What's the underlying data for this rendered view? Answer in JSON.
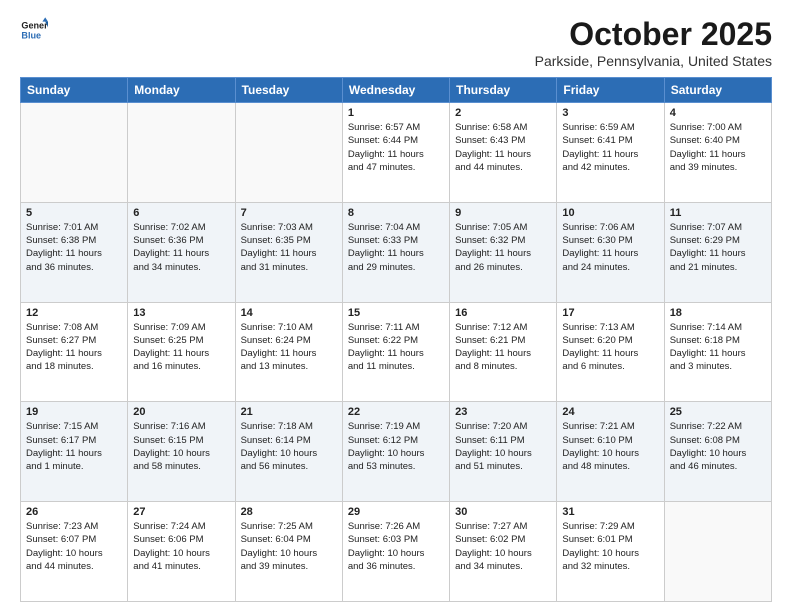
{
  "header": {
    "logo_line1": "General",
    "logo_line2": "Blue",
    "title": "October 2025",
    "subtitle": "Parkside, Pennsylvania, United States"
  },
  "days_of_week": [
    "Sunday",
    "Monday",
    "Tuesday",
    "Wednesday",
    "Thursday",
    "Friday",
    "Saturday"
  ],
  "weeks": [
    [
      {
        "day": "",
        "info": ""
      },
      {
        "day": "",
        "info": ""
      },
      {
        "day": "",
        "info": ""
      },
      {
        "day": "1",
        "info": "Sunrise: 6:57 AM\nSunset: 6:44 PM\nDaylight: 11 hours\nand 47 minutes."
      },
      {
        "day": "2",
        "info": "Sunrise: 6:58 AM\nSunset: 6:43 PM\nDaylight: 11 hours\nand 44 minutes."
      },
      {
        "day": "3",
        "info": "Sunrise: 6:59 AM\nSunset: 6:41 PM\nDaylight: 11 hours\nand 42 minutes."
      },
      {
        "day": "4",
        "info": "Sunrise: 7:00 AM\nSunset: 6:40 PM\nDaylight: 11 hours\nand 39 minutes."
      }
    ],
    [
      {
        "day": "5",
        "info": "Sunrise: 7:01 AM\nSunset: 6:38 PM\nDaylight: 11 hours\nand 36 minutes."
      },
      {
        "day": "6",
        "info": "Sunrise: 7:02 AM\nSunset: 6:36 PM\nDaylight: 11 hours\nand 34 minutes."
      },
      {
        "day": "7",
        "info": "Sunrise: 7:03 AM\nSunset: 6:35 PM\nDaylight: 11 hours\nand 31 minutes."
      },
      {
        "day": "8",
        "info": "Sunrise: 7:04 AM\nSunset: 6:33 PM\nDaylight: 11 hours\nand 29 minutes."
      },
      {
        "day": "9",
        "info": "Sunrise: 7:05 AM\nSunset: 6:32 PM\nDaylight: 11 hours\nand 26 minutes."
      },
      {
        "day": "10",
        "info": "Sunrise: 7:06 AM\nSunset: 6:30 PM\nDaylight: 11 hours\nand 24 minutes."
      },
      {
        "day": "11",
        "info": "Sunrise: 7:07 AM\nSunset: 6:29 PM\nDaylight: 11 hours\nand 21 minutes."
      }
    ],
    [
      {
        "day": "12",
        "info": "Sunrise: 7:08 AM\nSunset: 6:27 PM\nDaylight: 11 hours\nand 18 minutes."
      },
      {
        "day": "13",
        "info": "Sunrise: 7:09 AM\nSunset: 6:25 PM\nDaylight: 11 hours\nand 16 minutes."
      },
      {
        "day": "14",
        "info": "Sunrise: 7:10 AM\nSunset: 6:24 PM\nDaylight: 11 hours\nand 13 minutes."
      },
      {
        "day": "15",
        "info": "Sunrise: 7:11 AM\nSunset: 6:22 PM\nDaylight: 11 hours\nand 11 minutes."
      },
      {
        "day": "16",
        "info": "Sunrise: 7:12 AM\nSunset: 6:21 PM\nDaylight: 11 hours\nand 8 minutes."
      },
      {
        "day": "17",
        "info": "Sunrise: 7:13 AM\nSunset: 6:20 PM\nDaylight: 11 hours\nand 6 minutes."
      },
      {
        "day": "18",
        "info": "Sunrise: 7:14 AM\nSunset: 6:18 PM\nDaylight: 11 hours\nand 3 minutes."
      }
    ],
    [
      {
        "day": "19",
        "info": "Sunrise: 7:15 AM\nSunset: 6:17 PM\nDaylight: 11 hours\nand 1 minute."
      },
      {
        "day": "20",
        "info": "Sunrise: 7:16 AM\nSunset: 6:15 PM\nDaylight: 10 hours\nand 58 minutes."
      },
      {
        "day": "21",
        "info": "Sunrise: 7:18 AM\nSunset: 6:14 PM\nDaylight: 10 hours\nand 56 minutes."
      },
      {
        "day": "22",
        "info": "Sunrise: 7:19 AM\nSunset: 6:12 PM\nDaylight: 10 hours\nand 53 minutes."
      },
      {
        "day": "23",
        "info": "Sunrise: 7:20 AM\nSunset: 6:11 PM\nDaylight: 10 hours\nand 51 minutes."
      },
      {
        "day": "24",
        "info": "Sunrise: 7:21 AM\nSunset: 6:10 PM\nDaylight: 10 hours\nand 48 minutes."
      },
      {
        "day": "25",
        "info": "Sunrise: 7:22 AM\nSunset: 6:08 PM\nDaylight: 10 hours\nand 46 minutes."
      }
    ],
    [
      {
        "day": "26",
        "info": "Sunrise: 7:23 AM\nSunset: 6:07 PM\nDaylight: 10 hours\nand 44 minutes."
      },
      {
        "day": "27",
        "info": "Sunrise: 7:24 AM\nSunset: 6:06 PM\nDaylight: 10 hours\nand 41 minutes."
      },
      {
        "day": "28",
        "info": "Sunrise: 7:25 AM\nSunset: 6:04 PM\nDaylight: 10 hours\nand 39 minutes."
      },
      {
        "day": "29",
        "info": "Sunrise: 7:26 AM\nSunset: 6:03 PM\nDaylight: 10 hours\nand 36 minutes."
      },
      {
        "day": "30",
        "info": "Sunrise: 7:27 AM\nSunset: 6:02 PM\nDaylight: 10 hours\nand 34 minutes."
      },
      {
        "day": "31",
        "info": "Sunrise: 7:29 AM\nSunset: 6:01 PM\nDaylight: 10 hours\nand 32 minutes."
      },
      {
        "day": "",
        "info": ""
      }
    ]
  ]
}
